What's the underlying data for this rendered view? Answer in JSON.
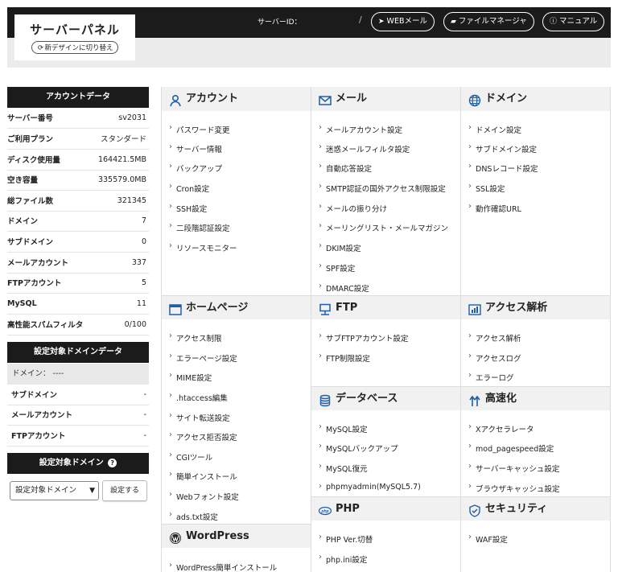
{
  "header": {
    "title": "サーバーパネル",
    "switch_label": "新デザインに切り替え",
    "server_id_label": "サーバーID：",
    "slash": "/",
    "webmail_label": "WEBメール",
    "filemanager_label": "ファイルマネージャ",
    "manual_label": "マニュアル"
  },
  "account_data": {
    "title": "アカウントデータ",
    "rows": [
      {
        "key": "サーバー番号",
        "value": "sv2031"
      },
      {
        "key": "ご利用プラン",
        "value": "スタンダード"
      },
      {
        "key": "ディスク使用量",
        "value": "164421.5MB"
      },
      {
        "key": "空き容量",
        "value": "335579.0MB"
      },
      {
        "key": "総ファイル数",
        "value": "321345"
      },
      {
        "key": "ドメイン",
        "value": "7"
      },
      {
        "key": "サブドメイン",
        "value": "0"
      },
      {
        "key": "メールアカウント",
        "value": "337"
      },
      {
        "key": "FTPアカウント",
        "value": "5"
      },
      {
        "key": "MySQL",
        "value": "11"
      },
      {
        "key": "高性能スパムフィルタ",
        "value": "0/100"
      }
    ]
  },
  "domain_data": {
    "title": "設定対象ドメインデータ",
    "domain_line": "ドメイン：  ----",
    "rows": [
      {
        "key": "サブドメイン",
        "value": "-"
      },
      {
        "key": "メールアカウント",
        "value": "-"
      },
      {
        "key": "FTPアカウント",
        "value": "-"
      }
    ]
  },
  "domain_select": {
    "title": "設定対象ドメイン",
    "help": "?",
    "selected": "設定対象ドメイン",
    "button": "設定する"
  },
  "sections": {
    "account": {
      "title": "アカウント",
      "links": [
        "パスワード変更",
        "サーバー情報",
        "バックアップ",
        "Cron設定",
        "SSH設定",
        "二段階認証設定",
        "リソースモニター"
      ]
    },
    "mail": {
      "title": "メール",
      "links": [
        "メールアカウント設定",
        "迷惑メールフィルタ設定",
        "自動応答設定",
        "SMTP認証の国外アクセス制限設定",
        "メールの振り分け",
        "メーリングリスト・メールマガジン",
        "DKIM設定",
        "SPF設定",
        "DMARC設定"
      ]
    },
    "domain": {
      "title": "ドメイン",
      "links": [
        "ドメイン設定",
        "サブドメイン設定",
        "DNSレコード設定",
        "SSL設定",
        "動作確認URL"
      ]
    },
    "homepage": {
      "title": "ホームページ",
      "links": [
        "アクセス制限",
        "エラーページ設定",
        "MIME設定",
        ".htaccess編集",
        "サイト転送設定",
        "アクセス拒否設定",
        "CGIツール",
        "簡単インストール",
        "Webフォント設定",
        "ads.txt設定"
      ]
    },
    "ftp": {
      "title": "FTP",
      "links": [
        "サブFTPアカウント設定",
        "FTP制限設定"
      ]
    },
    "analytics": {
      "title": "アクセス解析",
      "links": [
        "アクセス解析",
        "アクセスログ",
        "エラーログ"
      ]
    },
    "database": {
      "title": "データベース",
      "links": [
        "MySQL設定",
        "MySQLバックアップ",
        "MySQL復元",
        "phpmyadmin(MySQL5.7)"
      ]
    },
    "speed": {
      "title": "高速化",
      "links": [
        "Xアクセラレータ",
        "mod_pagespeed設定",
        "サーバーキャッシュ設定",
        "ブラウザキャッシュ設定"
      ]
    },
    "php": {
      "title": "PHP",
      "links": [
        "PHP Ver.切替",
        "php.ini設定"
      ]
    },
    "security": {
      "title": "セキュリティ",
      "links": [
        "WAF設定"
      ]
    },
    "wordpress": {
      "title": "WordPress",
      "links": [
        "WordPress簡単インストール"
      ]
    }
  },
  "colors": {
    "dark": "#1b1b1b",
    "accent": "#1e5fa8",
    "section_bg": "#f1f1f1"
  }
}
